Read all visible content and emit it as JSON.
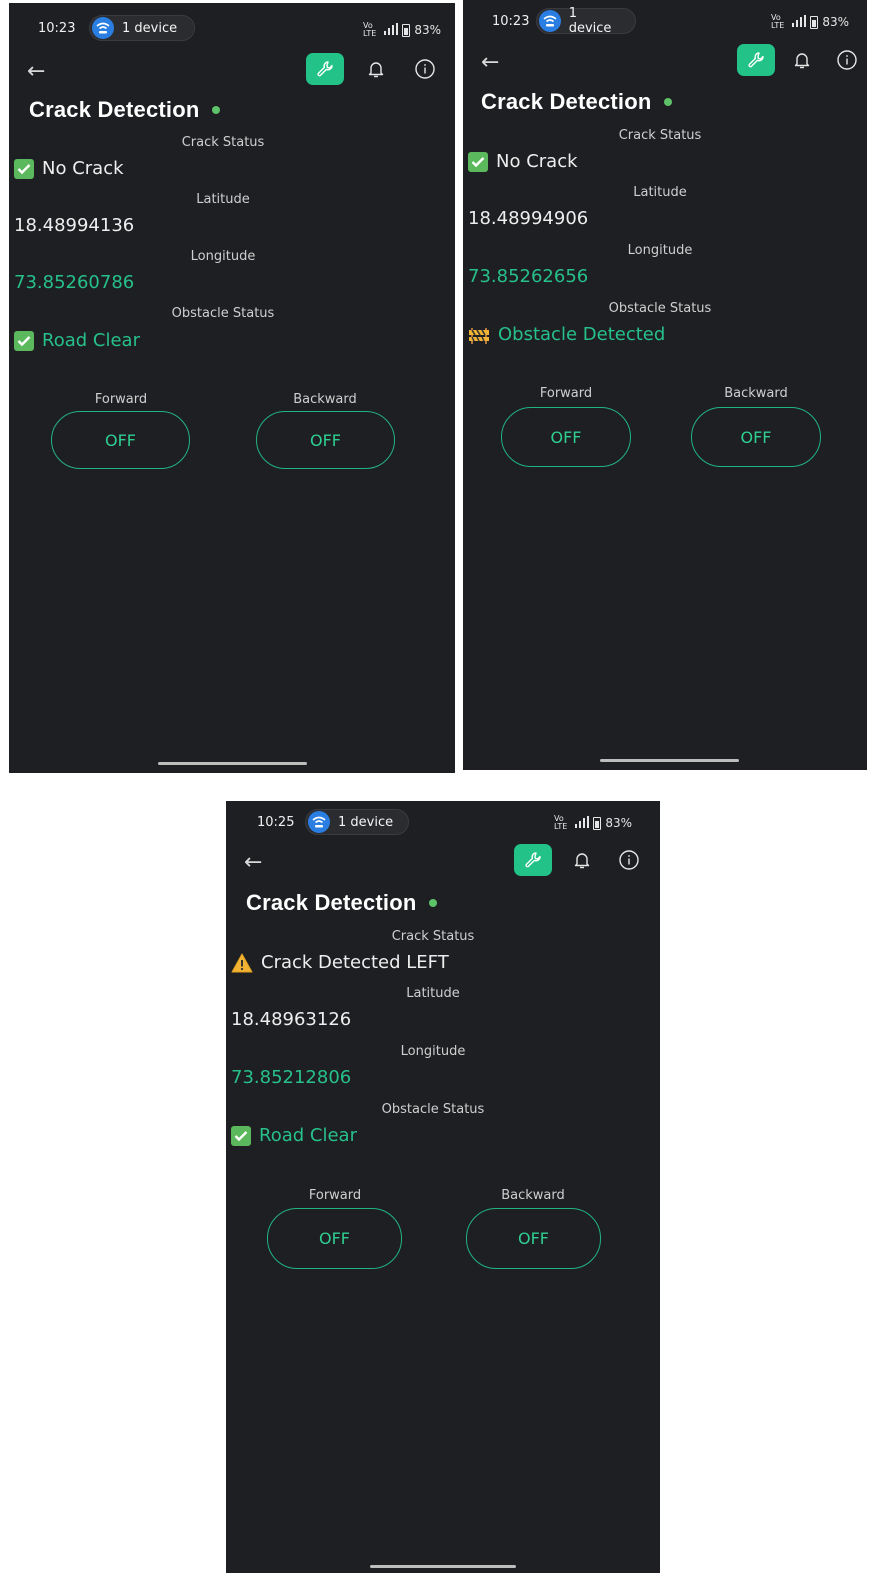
{
  "screens": [
    {
      "time": "10:23",
      "device_pill": "1 device",
      "network": "⁴ᴳ",
      "battery": "83%",
      "title": "Crack Detection",
      "crack": {
        "label": "Crack Status",
        "value": "No Crack",
        "icon": "check-icon"
      },
      "latitude": {
        "label": "Latitude",
        "value": "18.48994136"
      },
      "longitude": {
        "label": "Longitude",
        "value": "73.85260786"
      },
      "obstacle": {
        "label": "Obstacle Status",
        "value": "Road Clear",
        "icon": "check-icon"
      },
      "forward": {
        "label": "Forward",
        "state": "OFF"
      },
      "backward": {
        "label": "Backward",
        "state": "OFF"
      }
    },
    {
      "time": "10:23",
      "device_pill": "1 device",
      "network": "⁴ᴳ",
      "battery": "83%",
      "title": "Crack Detection",
      "crack": {
        "label": "Crack Status",
        "value": "No Crack",
        "icon": "check-icon"
      },
      "latitude": {
        "label": "Latitude",
        "value": "18.48994906"
      },
      "longitude": {
        "label": "Longitude",
        "value": "73.85262656"
      },
      "obstacle": {
        "label": "Obstacle Status",
        "value": "Obstacle Detected",
        "icon": "construction-barrier-icon"
      },
      "forward": {
        "label": "Forward",
        "state": "OFF"
      },
      "backward": {
        "label": "Backward",
        "state": "OFF"
      }
    },
    {
      "time": "10:25",
      "device_pill": "1 device",
      "network": "⁴ᴳ",
      "battery": "83%",
      "title": "Crack Detection",
      "crack": {
        "label": "Crack Status",
        "value": "Crack Detected LEFT",
        "icon": "warning-icon"
      },
      "latitude": {
        "label": "Latitude",
        "value": "18.48963126"
      },
      "longitude": {
        "label": "Longitude",
        "value": "73.85212806"
      },
      "obstacle": {
        "label": "Obstacle Status",
        "value": "Road Clear",
        "icon": "check-icon"
      },
      "forward": {
        "label": "Forward",
        "state": "OFF"
      },
      "backward": {
        "label": "Backward",
        "state": "OFF"
      }
    }
  ],
  "colors": {
    "background": "#1e1f22",
    "accent": "#22c288",
    "status_dot": "#5ec26a",
    "value_green": "#27c08a"
  }
}
